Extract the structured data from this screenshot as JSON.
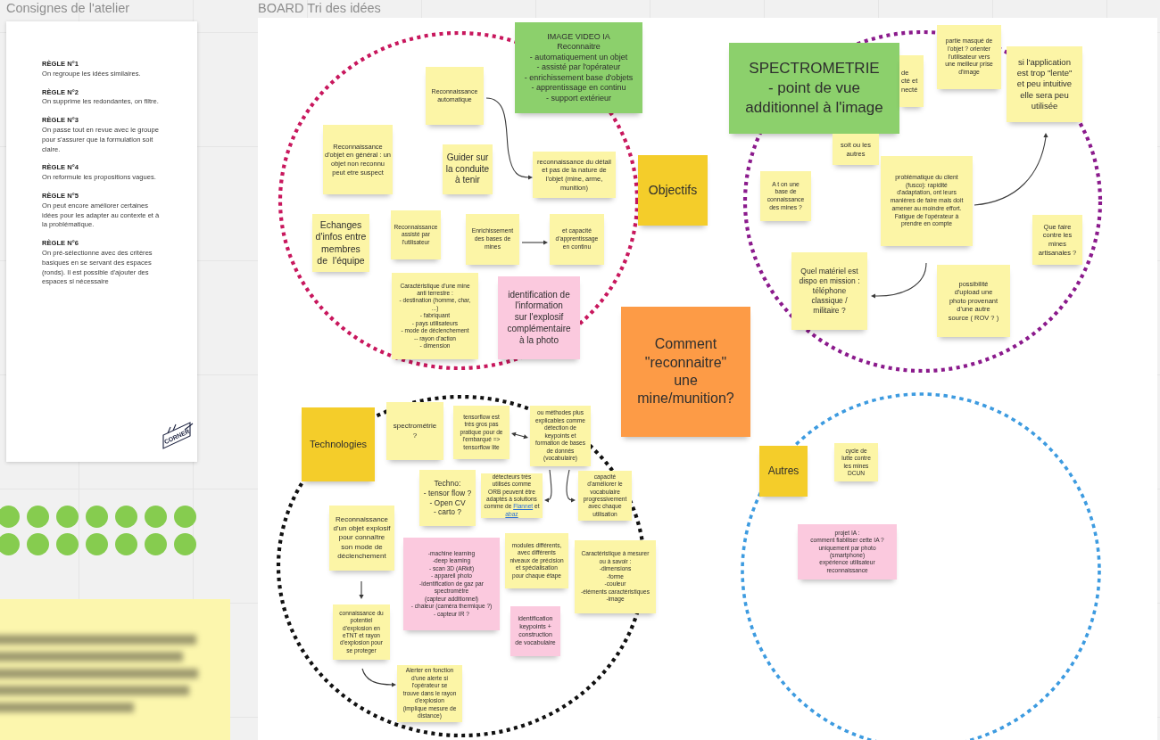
{
  "frames": [
    {
      "title": "Consignes de l'atelier"
    },
    {
      "title": "BOARD Tri des idées"
    }
  ],
  "rules_card": {
    "rules": [
      {
        "heading": "RÈGLE N°1",
        "text": "On regroupe les idées similaires."
      },
      {
        "heading": "RÈGLE N°2",
        "text": "On supprime les redondantes, on filtre."
      },
      {
        "heading": "RÈGLE N°3",
        "text": "On passe tout en revue avec le groupe pour s'assurer que la formulation soit claire."
      },
      {
        "heading": "RÈGLE N°4",
        "text": "On reformule les propositions vagues."
      },
      {
        "heading": "RÈGLE N°5",
        "text": "On peut encore améliorer certaines idées pour les adapter au contexte et à la problématique."
      },
      {
        "heading": "RÈGLE N°6",
        "text": "On pré-sélectionne avec des critères basiques en se servant des espaces (ronds). Il est possible d'ajouter des espaces si nécessaire"
      }
    ],
    "logo_text": "CORNER"
  },
  "board": {
    "zones": [
      {
        "color": "#c8175d"
      },
      {
        "color": "#8b1a8c"
      },
      {
        "color": "#111111"
      },
      {
        "color": "#3d9be0"
      }
    ],
    "notes": [
      {
        "text": "Reconnaissance\nautomatique",
        "color": "#fcf5a6"
      },
      {
        "text": "IMAGE VIDEO IA\nReconnaitre\n- automatiquement un objet\n- assisté par l'opérateur\n- enrichissement base d'objets\n- apprentissage en continu\n- support extérieur",
        "color": "#8cd06c"
      },
      {
        "text": "Reconnaissance d'objet en général : un objet non reconnu peut etre suspect",
        "color": "#fcf5a6"
      },
      {
        "text": "Guider sur la conduite à tenir",
        "color": "#fcf5a6"
      },
      {
        "text": "reconnaissance du détail et pas de la nature de l'objet (mine, arme, munition)",
        "color": "#fcf5a6"
      },
      {
        "text": "Objectifs",
        "color": "#f4cd2a"
      },
      {
        "text": "Echanges\nd'infos entre\nmembres\nde  l'équipe",
        "color": "#fcf5a6"
      },
      {
        "text": "Reconnaissance\nassisté par\nl'utilisateur",
        "color": "#fcf5a6"
      },
      {
        "text": "Enrichissement\ndes bases de\nmines",
        "color": "#fcf5a6"
      },
      {
        "text": "et capacité\nd'apprentissage\nen continu",
        "color": "#fcf5a6"
      },
      {
        "text": "Caractéristique d'une mine\nanti terrestre :\n- destination (homme, char,\n...)\n- fabriquant\n- pays utilisateurs\n- mode de déclenchement\n-- rayon d'action\n- dimension",
        "color": "#fcf5a6"
      },
      {
        "text": "identification de\nl'information\nsur l'explosif\ncomplémentaire\nà la photo",
        "color": "#fbc9de"
      },
      {
        "text": "SPECTROMETRIE\n- point de vue\nadditionnel à l'image",
        "color": "#8cd06c"
      },
      {
        "text": "de\ncté et\nnecté",
        "color": "#fcf5a6"
      },
      {
        "text": "partie masqué de\nl'objet ? orienter\nl'utilisateur vers\nune meilleur prise\nd'image",
        "color": "#fcf5a6"
      },
      {
        "text": "si l'application\nest trop \"lente\"\net peu intuitive\nelle sera peu\nutilisée",
        "color": "#fcf5a6"
      },
      {
        "text": "soit ou les\nautres",
        "color": "#fcf5a6"
      },
      {
        "text": "A t on une\nbase de\nconnaissance\ndes mines ?",
        "color": "#fcf5a6"
      },
      {
        "text": "problématique du client\n(fusco): rapidité\nd'adaptation, ont leurs\nmanières de faire mais doit\namener au moindre effort.\nFatigue de l'opérateur à\nprendre en compte",
        "color": "#fcf5a6"
      },
      {
        "text": "Que faire\ncontre les\nmines\nartisanales ?",
        "color": "#fcf5a6"
      },
      {
        "text": "Quel matériel est\ndispo en mission :\ntéléphone\nclassique /\nmilitaire ?",
        "color": "#fcf5a6"
      },
      {
        "text": "possibilité\nd'upload une\nphoto provenant\nd'une autre\nsource ( ROV ? )",
        "color": "#fcf5a6"
      },
      {
        "text": "Comment\n\"reconnaitre\"\nune\nmine/munition?",
        "color": "#fd9b46"
      },
      {
        "text": "Technologies",
        "color": "#f4cd2a"
      },
      {
        "text": "spectrométrie\n?",
        "color": "#fcf5a6"
      },
      {
        "text": "tensorflow est\ntrès gros pas\npratique pour de\nl'embarqué =>\ntensorflow lite",
        "color": "#fcf5a6"
      },
      {
        "text": "ou méthodes plus\nexplicables comme\ndétection de\nkeypoints et\nformation de bases\nde donnés\n(vocabulaire)",
        "color": "#fcf5a6"
      },
      {
        "text": "Techno:\n- tensor flow ?\n- Open CV\n- carto ?",
        "color": "#fcf5a6"
      },
      {
        "parts": [
          {
            "kind": "text",
            "text": "détecteurs très\nutilisés comme\nORB peuvent être\nadaptés à solutions\ncomme de "
          },
          {
            "kind": "link",
            "text": "Flannet"
          },
          {
            "kind": "text",
            "text": " et "
          },
          {
            "kind": "link",
            "text": "abaz"
          }
        ],
        "color": "#fcf5a6"
      },
      {
        "text": "capacité\nd'améliorer le\nvocabulaire\nprogressivement\navec chaque\nutilisation",
        "color": "#fcf5a6"
      },
      {
        "text": "Reconnaissance\nd'un objet explosif\npour connaître\nson mode de\ndéclenchement",
        "color": "#fcf5a6"
      },
      {
        "text": "-machine learning\n-deep learning\n- scan 3D (ARkit)\n- appareil photo\n-identification de gaz par\nspectromètre\n(capteur additionnel)\n- chaleur (caméra thermique ?)\n- capteur IR ?",
        "color": "#fbc9de"
      },
      {
        "text": "modules différents,\navec différents\nniveaux de précision\net spécialisation\npour chaque étape",
        "color": "#fcf5a6"
      },
      {
        "text": "Caractéristique à mesurer\nou à savoir :\n-dimensions\n-forme\n-couleur\n-éléments caractéristiques\n-image",
        "color": "#fcf5a6"
      },
      {
        "text": "connaissance du\npotentiel\nd'explosion en\neTNT et rayon\nd'explosion pour\nse proteger",
        "color": "#fcf5a6"
      },
      {
        "text": "identification\nkeypoints +\nconstruction\nde vocabulaire",
        "color": "#fbc9de"
      },
      {
        "text": "Alerter en fonction\nd'une alerte si\nl'opérateur se\ntrouve dans le rayon\nd'explosion\n(implique mesure de\ndistance)",
        "color": "#fcf5a6"
      },
      {
        "text": "Autres",
        "color": "#f4cd2a"
      },
      {
        "text": "cycle de\nlutte contre\nles mines\nDCUN",
        "color": "#fcf5a6"
      },
      {
        "text": "projet IA :\ncomment fiabiliser cette IA ?\nuniquement par photo\n(smartphone)\nexpérience utilisateur\nreconnaissance",
        "color": "#fbc9de"
      }
    ]
  }
}
